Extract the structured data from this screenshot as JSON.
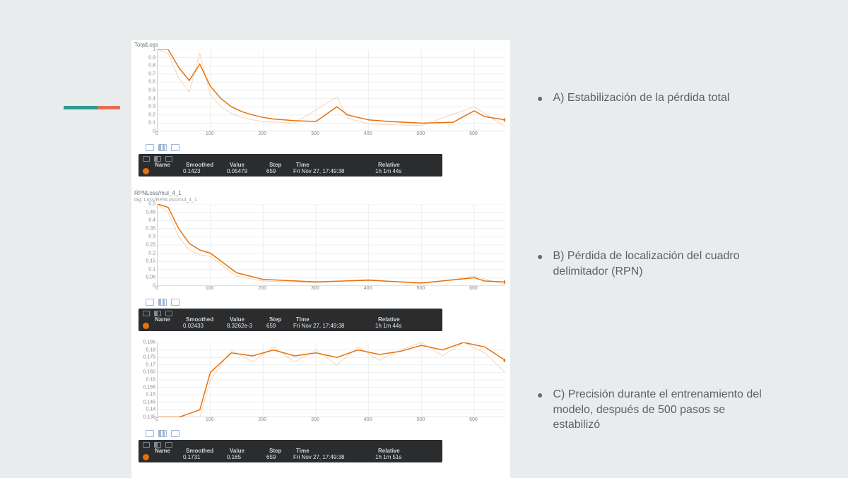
{
  "accent_colors": {
    "teal": "#2a9d8f",
    "orange": "#e76f51",
    "series": "#e8710a"
  },
  "descriptions": [
    "A)  Estabilización de la pérdida total",
    "B) Pérdida de localización del cuadro delimitador (RPN)",
    "C) Precisión durante el entrenamiento del modelo, después de 500 pasos se estabilizó"
  ],
  "panels": [
    {
      "title": "TotalLoss",
      "subtitle": "",
      "tooltip": {
        "headers": [
          "Name",
          "Smoothed",
          "Value",
          "Step",
          "Time",
          "Relative"
        ],
        "name": "",
        "smoothed": "0.1423",
        "value": "0.05479",
        "step": "659",
        "time": "Fri Nov 27, 17:49:38",
        "relative": "1h 1m 44s"
      }
    },
    {
      "title": "RPNLoss/mul_4_1",
      "subtitle": "tag: Loss/RPNLoss/mul_4_1",
      "tooltip": {
        "headers": [
          "Name",
          "Smoothed",
          "Value",
          "Step",
          "Time",
          "Relative"
        ],
        "name": "",
        "smoothed": "0.02433",
        "value": "8.3262e-3",
        "step": "659",
        "time": "Fri Nov 27, 17:49:38",
        "relative": "1h 1m 44s"
      }
    },
    {
      "title": "",
      "subtitle": "",
      "tooltip": {
        "headers": [
          "Name",
          "Smoothed",
          "Value",
          "Step",
          "Time",
          "Relative"
        ],
        "name": "",
        "smoothed": "0.1731",
        "value": "0.165",
        "step": "659",
        "time": "Fri Nov 27, 17:49:38",
        "relative": "1h 1m 51s"
      }
    }
  ],
  "chart_data": [
    {
      "type": "line",
      "title": "TotalLoss",
      "xlabel": "",
      "ylabel": "",
      "xlim": [
        0,
        659
      ],
      "ylim": [
        0,
        1.0
      ],
      "yticks": [
        0,
        0.1,
        0.2,
        0.3,
        0.4,
        0.5,
        0.6,
        0.7,
        0.8,
        0.9,
        1
      ],
      "xticks": [
        0,
        100,
        200,
        300,
        400,
        500,
        600
      ],
      "series": [
        {
          "name": "smoothed",
          "x": [
            0,
            20,
            40,
            60,
            80,
            100,
            120,
            140,
            160,
            180,
            200,
            220,
            260,
            300,
            340,
            360,
            400,
            440,
            500,
            560,
            600,
            620,
            659
          ],
          "values": [
            1.35,
            1.05,
            0.78,
            0.62,
            0.82,
            0.55,
            0.4,
            0.3,
            0.24,
            0.2,
            0.17,
            0.15,
            0.13,
            0.12,
            0.3,
            0.2,
            0.14,
            0.12,
            0.1,
            0.11,
            0.25,
            0.18,
            0.14
          ]
        },
        {
          "name": "raw",
          "x": [
            0,
            20,
            40,
            60,
            80,
            100,
            120,
            140,
            160,
            180,
            200,
            260,
            340,
            360,
            400,
            500,
            600,
            659
          ],
          "values": [
            1.45,
            0.95,
            0.65,
            0.48,
            0.95,
            0.45,
            0.3,
            0.22,
            0.17,
            0.14,
            0.12,
            0.1,
            0.42,
            0.16,
            0.09,
            0.07,
            0.3,
            0.055
          ]
        }
      ]
    },
    {
      "type": "line",
      "title": "RPNLoss/mul_4_1",
      "xlabel": "",
      "ylabel": "",
      "xlim": [
        0,
        659
      ],
      "ylim": [
        0,
        0.5
      ],
      "yticks": [
        0,
        0.05,
        0.1,
        0.15,
        0.2,
        0.25,
        0.3,
        0.35,
        0.4,
        0.45,
        0.5
      ],
      "xticks": [
        0,
        100,
        200,
        300,
        400,
        500,
        600
      ],
      "series": [
        {
          "name": "smoothed",
          "x": [
            0,
            20,
            40,
            60,
            80,
            100,
            150,
            200,
            300,
            400,
            500,
            600,
            620,
            659
          ],
          "values": [
            0.6,
            0.48,
            0.35,
            0.26,
            0.22,
            0.2,
            0.08,
            0.04,
            0.025,
            0.035,
            0.018,
            0.05,
            0.03,
            0.024
          ]
        },
        {
          "name": "raw",
          "x": [
            0,
            20,
            40,
            60,
            80,
            100,
            150,
            200,
            300,
            400,
            500,
            600,
            659
          ],
          "values": [
            0.62,
            0.45,
            0.3,
            0.22,
            0.19,
            0.18,
            0.06,
            0.03,
            0.02,
            0.04,
            0.012,
            0.06,
            0.0083
          ]
        }
      ]
    },
    {
      "type": "line",
      "title": "",
      "xlabel": "",
      "ylabel": "",
      "xlim": [
        0,
        659
      ],
      "ylim": [
        0.135,
        0.185
      ],
      "yticks": [
        0.135,
        0.14,
        0.145,
        0.15,
        0.155,
        0.16,
        0.165,
        0.17,
        0.175,
        0.18,
        0.185
      ],
      "xticks": [
        0,
        100,
        200,
        300,
        400,
        500,
        600
      ],
      "series": [
        {
          "name": "smoothed",
          "x": [
            0,
            40,
            80,
            100,
            140,
            180,
            220,
            260,
            300,
            340,
            380,
            420,
            460,
            500,
            540,
            580,
            620,
            659
          ],
          "values": [
            0.125,
            0.13,
            0.14,
            0.165,
            0.178,
            0.176,
            0.18,
            0.176,
            0.178,
            0.175,
            0.18,
            0.177,
            0.179,
            0.183,
            0.18,
            0.186,
            0.182,
            0.173
          ]
        },
        {
          "name": "raw",
          "x": [
            0,
            40,
            80,
            100,
            140,
            180,
            220,
            260,
            300,
            340,
            380,
            420,
            460,
            500,
            540,
            580,
            620,
            659
          ],
          "values": [
            0.12,
            0.128,
            0.135,
            0.16,
            0.18,
            0.172,
            0.182,
            0.172,
            0.18,
            0.17,
            0.182,
            0.173,
            0.18,
            0.186,
            0.176,
            0.188,
            0.178,
            0.165
          ]
        }
      ]
    }
  ]
}
